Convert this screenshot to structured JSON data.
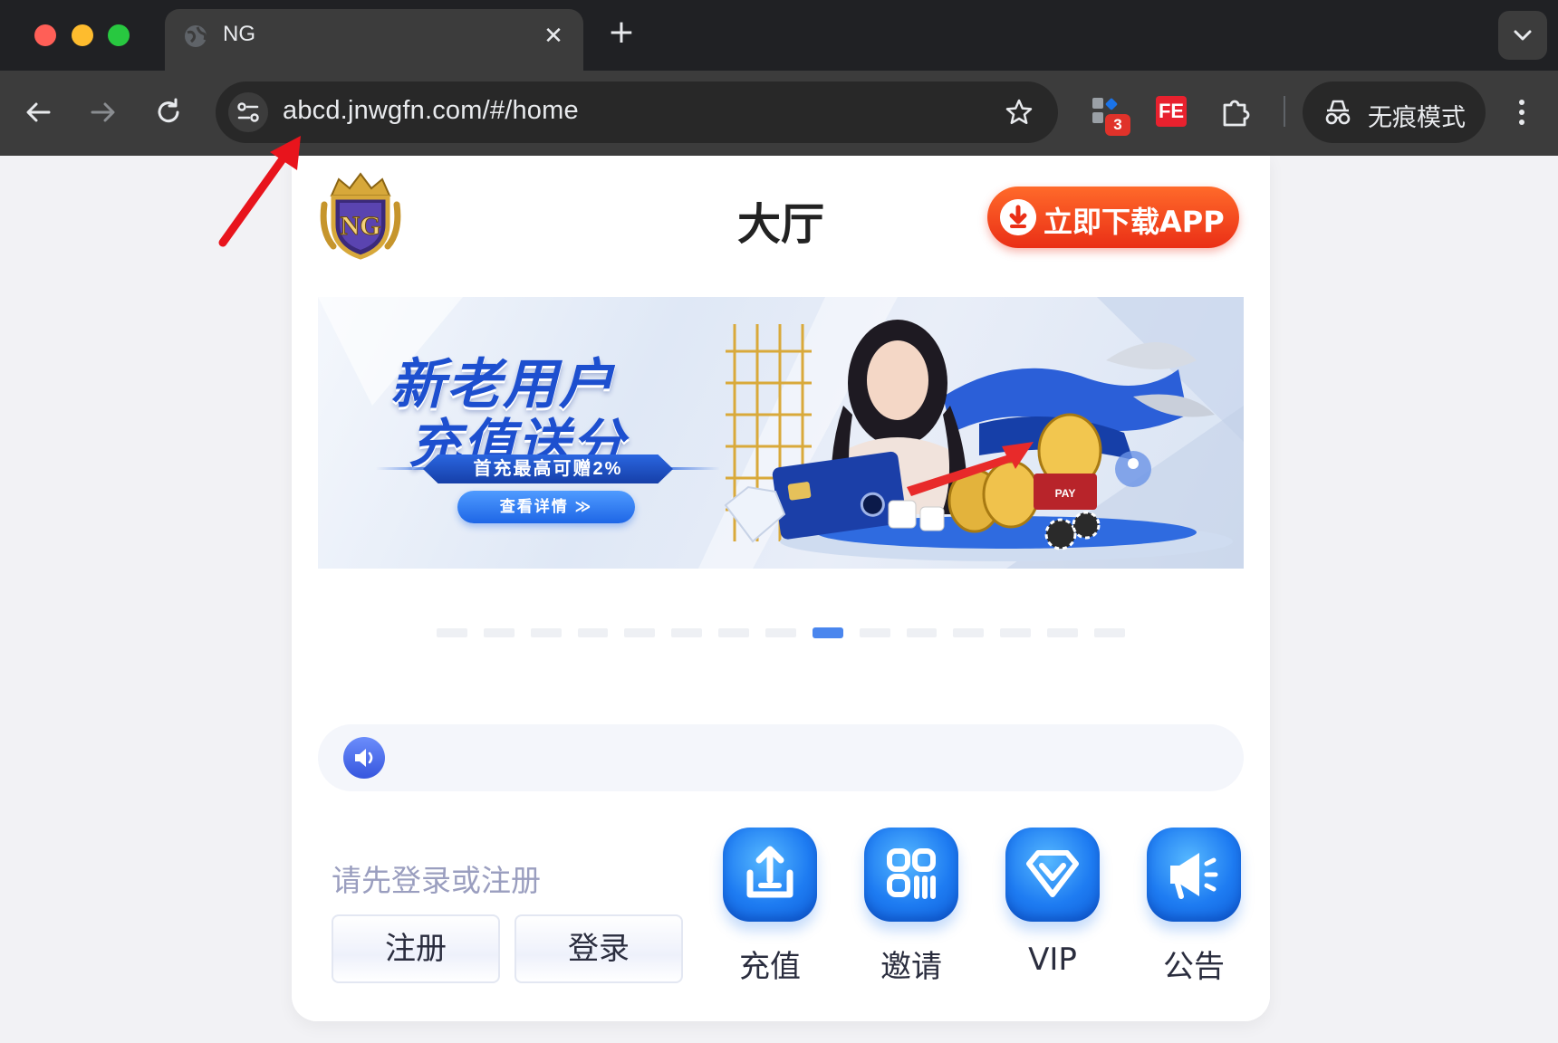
{
  "browser": {
    "tab_title": "NG",
    "tab_close": "✕",
    "new_tab": "+",
    "url": "abcd.jnwgfn.com/#/home",
    "extension_badge": "3",
    "fe_extension": "FE",
    "incognito_label": "无痕模式"
  },
  "header": {
    "logo_text": "NG",
    "title": "大厅",
    "download_label": "立即下载APP"
  },
  "banner": {
    "headline_1": "新老用户",
    "headline_2": "充值送分",
    "ribbon": "首充最高可赠2%",
    "cta": "查看详情 ≫",
    "active_slide": 9,
    "total_slides": 15
  },
  "account": {
    "prompt": "请先登录或注册",
    "register": "注册",
    "login": "登录"
  },
  "actions": [
    {
      "label": "充值",
      "icon": "upload-icon"
    },
    {
      "label": "邀请",
      "icon": "qr-code-icon"
    },
    {
      "label": "VIP",
      "icon": "diamond-icon"
    },
    {
      "label": "公告",
      "icon": "megaphone-icon"
    }
  ],
  "colors": {
    "accent_blue": "#1e7cf2",
    "download_red": "#ea2f16",
    "annotation_arrow": "#e8141c"
  }
}
